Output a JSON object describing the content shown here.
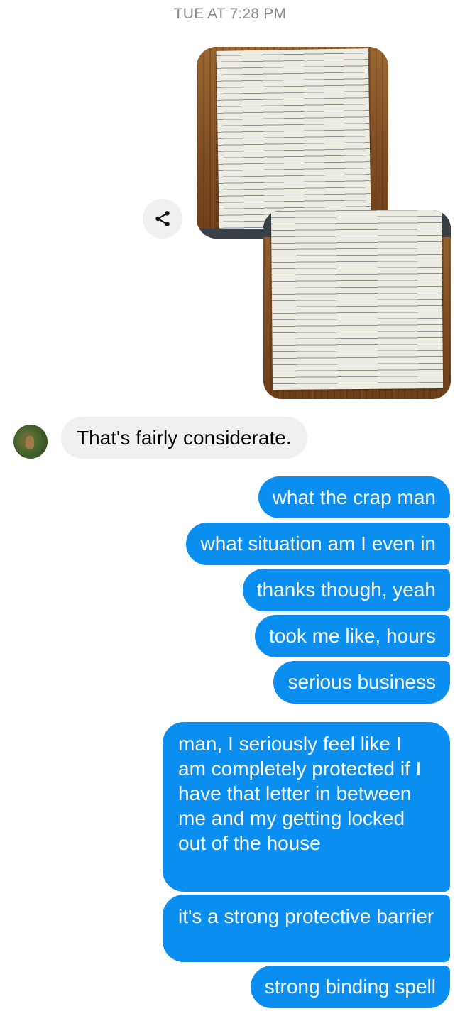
{
  "conversation": {
    "timestamp": "TUE AT 7:28 PM",
    "incoming": [
      {
        "text": "That's fairly considerate."
      }
    ],
    "outgoing": [
      {
        "text": "what the crap man"
      },
      {
        "text": "what situation am I even in"
      },
      {
        "text": "thanks though, yeah"
      },
      {
        "text": "took me like, hours"
      },
      {
        "text": "serious business"
      },
      {
        "text": "man, I seriously feel like I am completely protected if I have that letter in between me and my getting locked out of the house"
      },
      {
        "text": "it's a strong protective barrier"
      },
      {
        "text": "strong binding spell"
      }
    ]
  },
  "colors": {
    "outgoing_bubble": "#0a8ff0",
    "incoming_bubble": "#f0f0f0",
    "timestamp": "#8a8a8a"
  },
  "icons": {
    "share": "share-icon"
  }
}
